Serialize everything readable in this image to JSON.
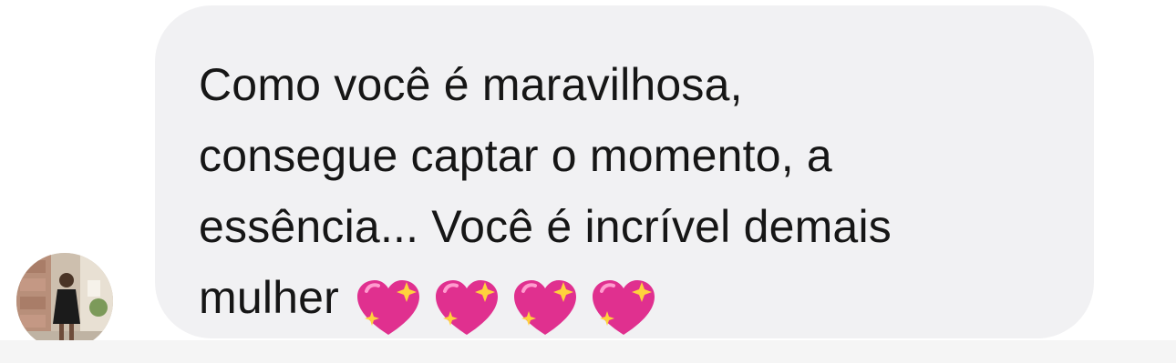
{
  "conversation": {
    "message_lines": [
      "Como você é maravilhosa,",
      "consegue captar o momento, a",
      "essência... Você é incrível demais",
      "mulher"
    ],
    "emoji": [
      "sparkling-heart",
      "sparkling-heart",
      "sparkling-heart",
      "sparkling-heart"
    ]
  },
  "colors": {
    "bubble": "#f1f1f3",
    "text": "#161616",
    "heart": "#e0308f",
    "sparkle": "#ffd23c",
    "bottom_strip": "#f5f5f5"
  }
}
